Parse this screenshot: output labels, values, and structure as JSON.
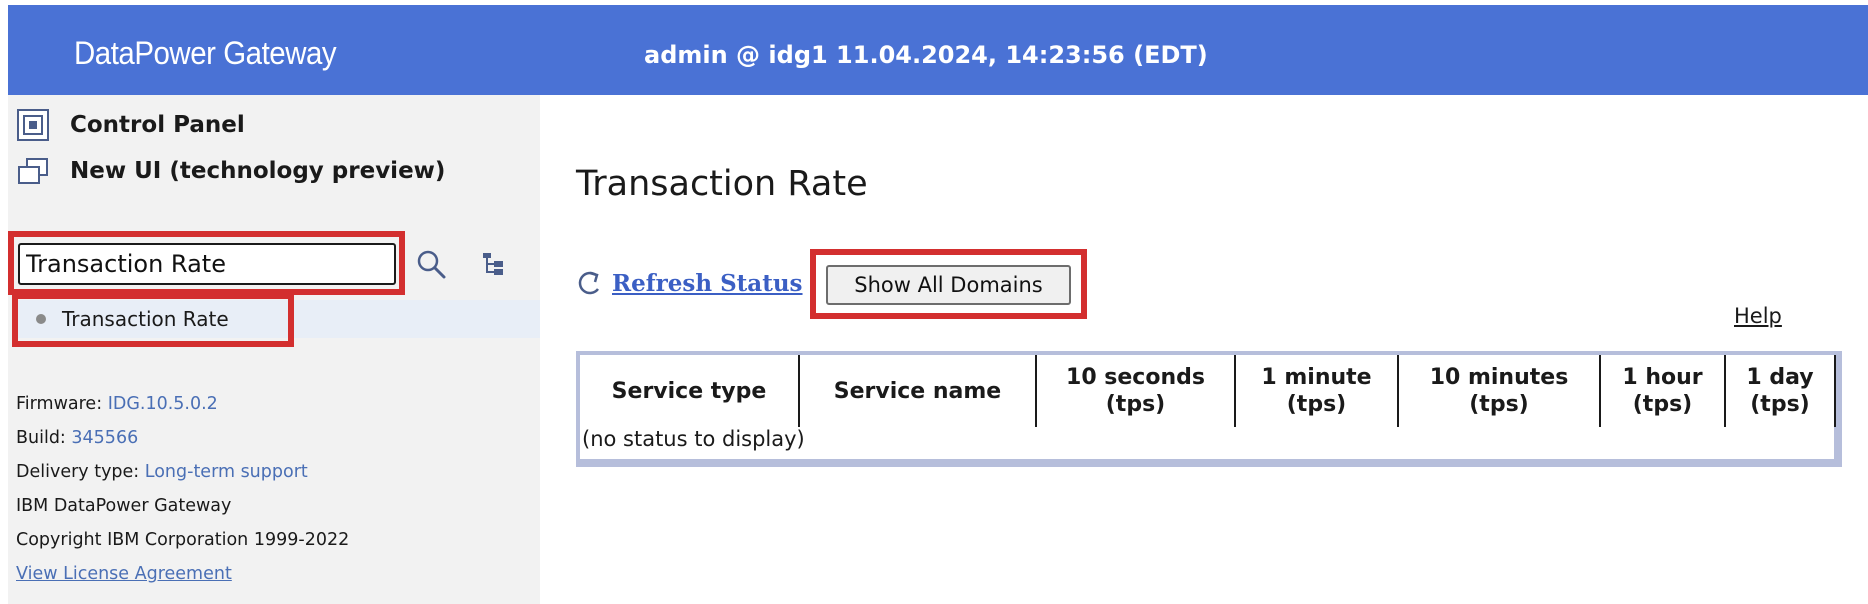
{
  "header": {
    "brand": "DataPower Gateway",
    "session": "admin @ idg1 11.04.2024, 14:23:56 (EDT)",
    "color": "#4a72d5"
  },
  "sidebar": {
    "control_panel_label": "Control Panel",
    "new_ui_label": "New UI (technology preview)",
    "search": {
      "value": "Transaction Rate"
    },
    "results": [
      {
        "label": "Transaction Rate"
      }
    ],
    "info": {
      "firmware_label": "Firmware:",
      "firmware_value": "IDG.10.5.0.2",
      "build_label": "Build:",
      "build_value": "345566",
      "delivery_label": "Delivery type:",
      "delivery_value": "Long-term support",
      "product": "IBM DataPower Gateway",
      "copyright": "Copyright IBM Corporation 1999-2022",
      "license_link": "View License Agreement"
    }
  },
  "main": {
    "title": "Transaction Rate",
    "refresh_label": "Refresh Status",
    "show_all_domains_label": "Show All Domains",
    "help_label": "Help",
    "table": {
      "columns": [
        "Service type",
        "Service name",
        "10 seconds\n(tps)",
        "1 minute\n(tps)",
        "10 minutes\n(tps)",
        "1 hour\n(tps)",
        "1 day\n(tps)"
      ],
      "empty_message": "(no status to display)"
    }
  },
  "highlight_color": "#d32f2f",
  "icons": [
    "control-panel-icon",
    "new-ui-icon",
    "search-icon",
    "tree-icon",
    "refresh-icon"
  ]
}
